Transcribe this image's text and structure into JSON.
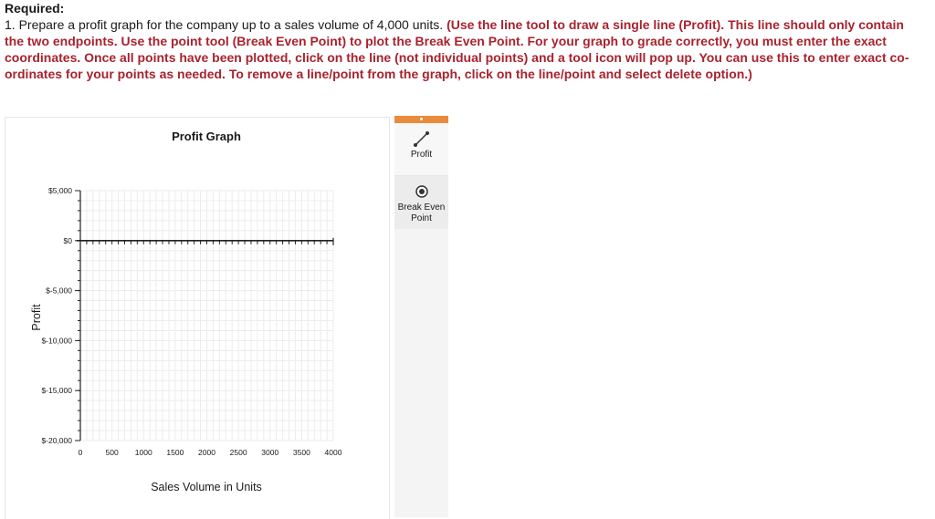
{
  "instructions": {
    "heading": "Required:",
    "step": "1. Prepare a profit graph for the company up to a sales volume of 4,000 units. ",
    "emphasis": "(Use the line tool to draw a single line (Profit). This line should only contain the two endpoints. Use the point tool (Break Even Point) to plot the Break Even Point. For your graph to grade correctly, you must enter the exact coordinates. Once all points have been plotted, click on the line (not individual points) and a tool icon will pop up. You can use this to enter exact co-ordinates for your points as needed. To remove a line/point from the graph, click on the line/point and select delete option.)"
  },
  "tools": {
    "line_tool_label": "Profit",
    "line_tool_icon": "line-tool-icon",
    "point_tool_label_line1": "Break Even",
    "point_tool_label_line2": "Point",
    "point_tool_icon": "point-tool-icon",
    "header_color": "#e98b3a"
  },
  "chart_data": {
    "type": "line",
    "title": "Profit Graph",
    "xlabel": "Sales Volume in Units",
    "ylabel": "Profit",
    "xlim": [
      0,
      4000
    ],
    "ylim": [
      -20000,
      5000
    ],
    "x_ticks": [
      0,
      500,
      1000,
      1500,
      2000,
      2500,
      3000,
      3500,
      4000
    ],
    "x_tick_labels": [
      "0",
      "500",
      "1000",
      "1500",
      "2000",
      "2500",
      "3000",
      "3500",
      "4000"
    ],
    "y_ticks": [
      5000,
      0,
      -5000,
      -10000,
      -15000,
      -20000
    ],
    "y_tick_labels": [
      "$5,000",
      "$0",
      "$-5,000",
      "$-10,000",
      "$-15,000",
      "$-20,000"
    ],
    "grid": true,
    "series": []
  }
}
